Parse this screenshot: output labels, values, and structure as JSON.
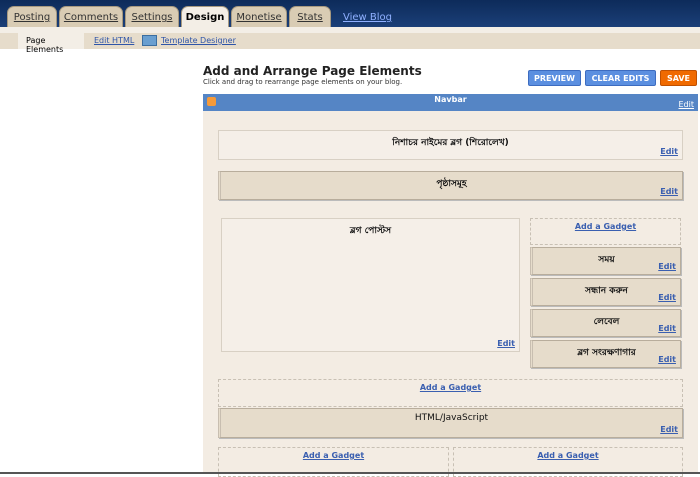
{
  "tabs": [
    {
      "label": "Posting"
    },
    {
      "label": "Comments"
    },
    {
      "label": "Settings"
    },
    {
      "label": "Design"
    },
    {
      "label": "Monetise"
    },
    {
      "label": "Stats"
    }
  ],
  "view_blog": "View Blog",
  "subnav": {
    "page_elements": "Page Elements",
    "edit_html": "Edit HTML",
    "template_designer": "Template Designer"
  },
  "header": {
    "title": "Add and Arrange Page Elements",
    "subtitle": "Click and drag to rearrange page elements on your blog."
  },
  "buttons": {
    "preview": "PREVIEW",
    "clear": "CLEAR EDITS",
    "save": "SAVE"
  },
  "navbar": {
    "label": "Navbar",
    "edit": "Edit"
  },
  "elements": {
    "blog_header": "নিশাচর নাইমের ব্লগ (শিরোলেখ)",
    "pages": "পৃষ্ঠাসমূহ",
    "posts": "ব্লগ পোস্টস",
    "sidebar": [
      "সময়",
      "সন্ধান করুন",
      "লেবেল",
      "ব্লগ সংরক্ষণাগার"
    ],
    "html_js": "HTML/JavaScript",
    "edit": "Edit",
    "add_gadget": "Add a Gadget"
  }
}
